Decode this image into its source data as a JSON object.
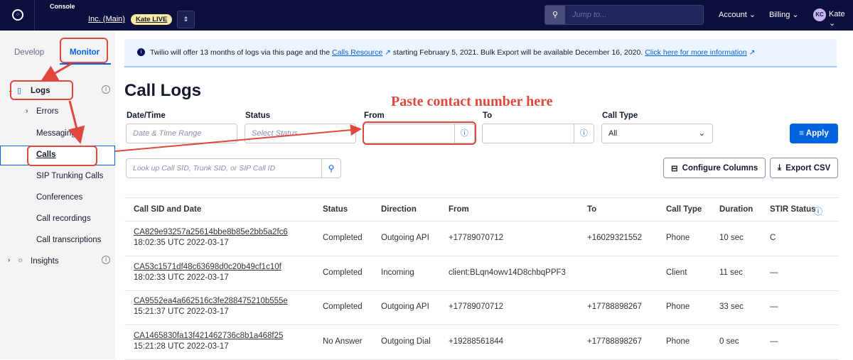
{
  "topbar": {
    "console_label": "Console",
    "account_name": "Inc. (Main)",
    "badge": "Kate LIVE",
    "search_placeholder": "Jump to...",
    "account_menu": "Account",
    "billing_menu": "Billing",
    "avatar_initials": "KC",
    "user_menu": "Kate"
  },
  "sidebar": {
    "tabs": [
      "Develop",
      "Monitor"
    ],
    "logs_label": "Logs",
    "items": [
      "Errors",
      "Messaging",
      "Calls",
      "SIP Trunking Calls",
      "Conferences",
      "Call recordings",
      "Call transcriptions"
    ],
    "insights_label": "Insights"
  },
  "banner": {
    "text_1": "Twilio will offer 13 months of logs via this page and the",
    "link_1": "Calls Resource",
    "text_2": "starting February 5, 2021. Bulk Export will be available December 16, 2020.",
    "link_2": "Click here for more information"
  },
  "page_title": "Call Logs",
  "filters": {
    "datetime_label": "Date/Time",
    "datetime_placeholder": "Date & Time Range",
    "status_label": "Status",
    "status_placeholder": "Select Status",
    "from_label": "From",
    "to_label": "To",
    "calltype_label": "Call Type",
    "calltype_value": "All",
    "apply": "Apply"
  },
  "search_placeholder": "Look up Call SID, Trunk SID, or SIP Call ID",
  "configure_columns": "Configure Columns",
  "export_csv": "Export CSV",
  "table": {
    "headers": [
      "Call SID and Date",
      "Status",
      "Direction",
      "From",
      "To",
      "Call Type",
      "Duration",
      "STIR Status"
    ],
    "rows": [
      {
        "sid": "CA829e93257a25614bbe8b85e2bb5a2fc6",
        "date": "18:02:35 UTC 2022-03-17",
        "status": "Completed",
        "direction": "Outgoing API",
        "from": "+17789070712",
        "to": "+16029321552",
        "type": "Phone",
        "duration": "10 sec",
        "stir": "C"
      },
      {
        "sid": "CA53c1571df48c63698d0c20b49cf1c10f",
        "date": "18:02:33 UTC 2022-03-17",
        "status": "Completed",
        "direction": "Incoming",
        "from": "client:BLqn4owv14D8chbqPPF3",
        "to": "",
        "type": "Client",
        "duration": "11 sec",
        "stir": "—"
      },
      {
        "sid": "CA9552ea4a662516c3fe288475210b555e",
        "date": "15:21:37 UTC 2022-03-17",
        "status": "Completed",
        "direction": "Outgoing API",
        "from": "+17789070712",
        "to": "+17788898267",
        "type": "Phone",
        "duration": "33 sec",
        "stir": "—"
      },
      {
        "sid": "CA1465830fa13f421462736c8b1a468f25",
        "date": "15:21:28 UTC 2022-03-17",
        "status": "No Answer",
        "direction": "Outgoing Dial",
        "from": "+19288561844",
        "to": "+17788898267",
        "type": "Phone",
        "duration": "0 sec",
        "stir": "—"
      }
    ]
  },
  "annotation": "Paste contact number here"
}
